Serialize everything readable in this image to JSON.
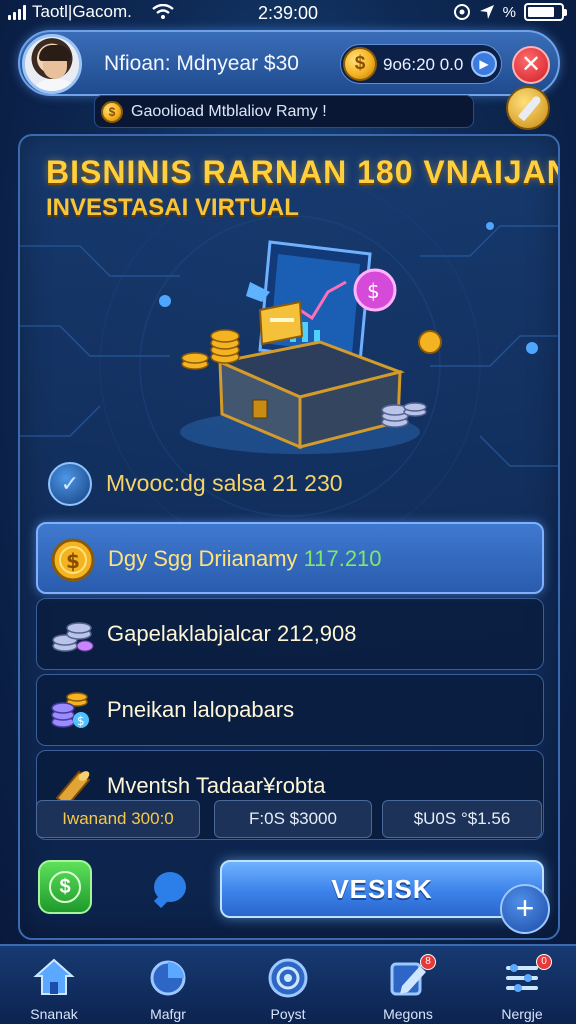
{
  "status_bar": {
    "carrier": "Taotl|Gacom.",
    "time": "2:39:00",
    "battery_text": "%"
  },
  "header": {
    "player_name": "Nfioan: Mdnyear $30",
    "balance": "9o6:20 0.0",
    "coin_symbol": "$",
    "close_label": "✕"
  },
  "notice": {
    "text": "Gaoolioad Mtblaliov Ramy !"
  },
  "title": {
    "main": "BISNINIS RARNAN 180 VNAIJAN",
    "sub": "INVESTASAI VIRTUAL"
  },
  "stats": {
    "row_text": "Mvooc:dg salsa 21 230"
  },
  "cards": [
    {
      "label": "Dgy Sgg Driianamy",
      "value": "117.210",
      "active": true,
      "icon": "gold-coin-icon"
    },
    {
      "label": "Gapelaklabjalcar 212,908",
      "active": false,
      "icon": "coin-stack-icon"
    },
    {
      "label": "Pneikan lalopabars",
      "active": false,
      "icon": "coins-dollar-icon"
    },
    {
      "label": "Mventsh Tadaar¥robta",
      "active": false,
      "icon": "scroll-icon"
    }
  ],
  "tiles": [
    {
      "text": "Iwanand 300:0",
      "gold": true
    },
    {
      "text": "F:0S $3000",
      "gold": false
    },
    {
      "text": "$U0S °$1.56",
      "gold": false
    }
  ],
  "actions": {
    "primary_label": "VESISK",
    "cash_symbol": "$",
    "fab_symbol": "+"
  },
  "nav": [
    {
      "label": "Snanak",
      "icon": "home-icon",
      "badge": ""
    },
    {
      "label": "Mafgr",
      "icon": "chart-circle-icon",
      "badge": ""
    },
    {
      "label": "Poyst",
      "icon": "target-icon",
      "badge": ""
    },
    {
      "label": "Megons",
      "icon": "edit-icon",
      "badge": "8"
    },
    {
      "label": "Nergje",
      "icon": "settings-list-icon",
      "badge": "0"
    }
  ],
  "colors": {
    "accent_gold": "#ffcf3d",
    "accent_blue": "#3c82ea",
    "value_green": "#7de86a",
    "background": "#0e2a55"
  }
}
